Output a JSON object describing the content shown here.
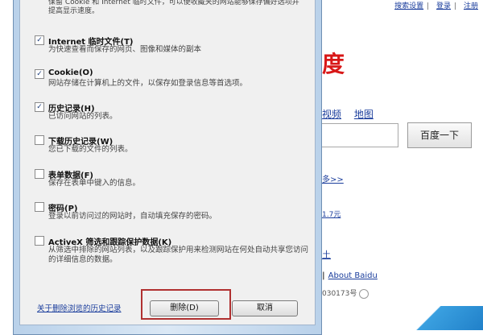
{
  "browser": {
    "top_links": [
      "搜索设置",
      "登录",
      "注册"
    ],
    "logo_fragment": "度",
    "nav_links": [
      "视频",
      "地图"
    ],
    "search_button": "百度一下",
    "more_link": "多>>",
    "price_text": "1.7元",
    "tu_link": "土",
    "about_prefix": "|",
    "about_link": "About Baidu",
    "icp_text": "030173号"
  },
  "dialog": {
    "intro": "保留 Cookie 和 Internet 临时文件，可以使收藏夹的网站能够保存偏好选项并提高显示速度。",
    "options": [
      {
        "checked": true,
        "title": "Internet 临时文件(T)",
        "desc": "为快速查看而保存的网页、图像和媒体的副本"
      },
      {
        "checked": true,
        "title": "Cookie(O)",
        "desc": "网站存储在计算机上的文件，以保存如登录信息等首选项。"
      },
      {
        "checked": true,
        "title": "历史记录(H)",
        "desc": "已访问网站的列表。"
      },
      {
        "checked": false,
        "title": "下载历史记录(W)",
        "desc": "您已下载的文件的列表。"
      },
      {
        "checked": false,
        "title": "表单数据(F)",
        "desc": "保存在表单中键入的信息。"
      },
      {
        "checked": false,
        "title": "密码(P)",
        "desc": "登录以前访问过的网站时，自动填充保存的密码。"
      },
      {
        "checked": false,
        "title": "ActiveX 筛选和跟踪保护数据(K)",
        "desc": "从筛选中排除的网站列表，以及跟踪保护用来检测网站在何处自动共享您访问的详细信息的数据。"
      }
    ],
    "history_link": "关于删除浏览的历史记录",
    "delete_button": "删除(D)",
    "cancel_button": "取消"
  },
  "colors": {
    "highlight_border": "#b03030",
    "link": "#1a3d9c",
    "logo_red": "#d81818"
  }
}
